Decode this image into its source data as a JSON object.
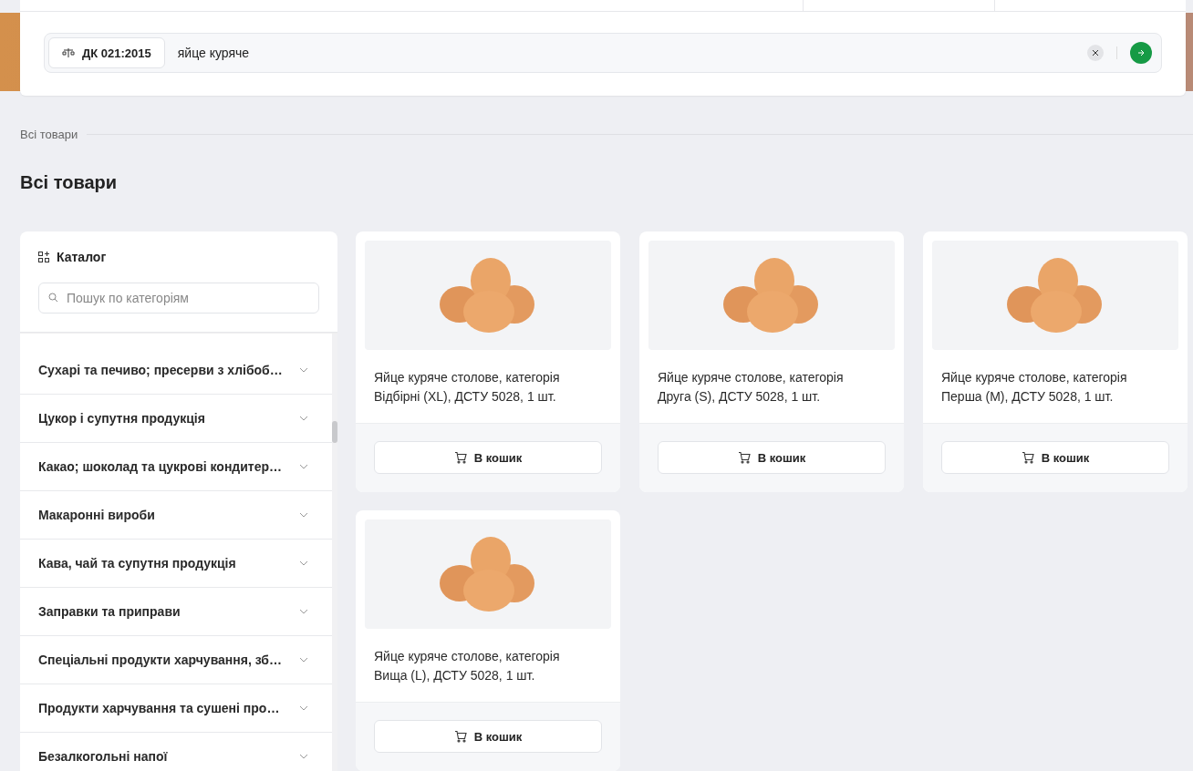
{
  "search": {
    "classifier": "ДК 021:2015",
    "value": "яйце куряче"
  },
  "breadcrumb": "Всі товари",
  "heading": "Всі товари",
  "catalog": {
    "title": "Каталог",
    "search_placeholder": "Пошук по категоріям",
    "categories": [
      {
        "label": "Сухарі та печиво; пресерви з хлібоб…",
        "expanded": false
      },
      {
        "label": "Цукор і супутня продукція",
        "expanded": false
      },
      {
        "label": "Какао; шоколад та цукрові кондитер…",
        "expanded": false
      },
      {
        "label": "Макаронні вироби",
        "expanded": false
      },
      {
        "label": "Кава, чай та супутня продукція",
        "expanded": false
      },
      {
        "label": "Заправки та приправи",
        "expanded": false
      },
      {
        "label": "Спеціальні продукти харчування, зб…",
        "expanded": false
      },
      {
        "label": "Продукти харчування та сушені про…",
        "expanded": false
      },
      {
        "label": "Безалкогольні напої",
        "expanded": false
      }
    ]
  },
  "products": [
    {
      "name": "Яйце куряче столове, категорія Відбірні (XL), ДСТУ 5028, 1 шт.",
      "button": "В кошик"
    },
    {
      "name": "Яйце куряче столове, категорія Друга (S), ДСТУ 5028, 1 шт.",
      "button": "В кошик"
    },
    {
      "name": "Яйце куряче столове, категорія Перша (M), ДСТУ 5028, 1 шт.",
      "button": "В кошик"
    },
    {
      "name": "Яйце куряче столове, категорія Вища (L), ДСТУ 5028, 1 шт.",
      "button": "В кошик"
    }
  ]
}
